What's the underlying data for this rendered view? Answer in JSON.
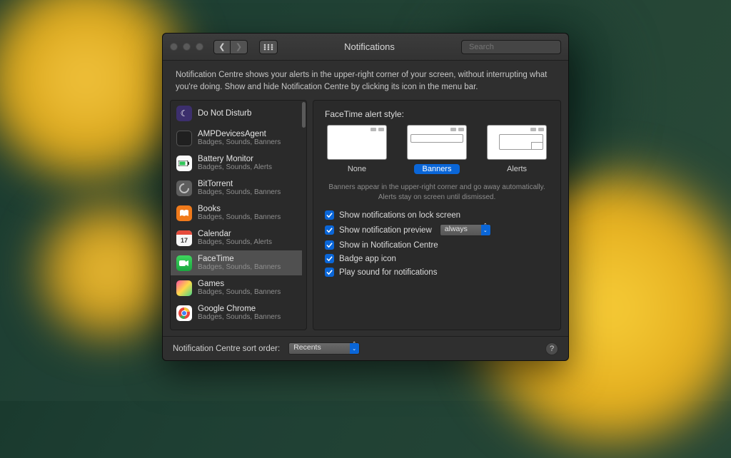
{
  "window": {
    "title": "Notifications",
    "search_placeholder": "Search"
  },
  "description": "Notification Centre shows your alerts in the upper-right corner of your screen, without interrupting what you're doing. Show and hide Notification Centre by clicking its icon in the menu bar.",
  "sidebar": {
    "items": [
      {
        "name": "Do Not Disturb",
        "sub": ""
      },
      {
        "name": "AMPDevicesAgent",
        "sub": "Badges, Sounds, Banners"
      },
      {
        "name": "Battery Monitor",
        "sub": "Badges, Sounds, Alerts"
      },
      {
        "name": "BitTorrent",
        "sub": "Badges, Sounds, Banners"
      },
      {
        "name": "Books",
        "sub": "Badges, Sounds, Banners"
      },
      {
        "name": "Calendar",
        "sub": "Badges, Sounds, Alerts"
      },
      {
        "name": "FaceTime",
        "sub": "Badges, Sounds, Banners"
      },
      {
        "name": "Games",
        "sub": "Badges, Sounds, Banners"
      },
      {
        "name": "Google Chrome",
        "sub": "Badges, Sounds, Banners"
      }
    ],
    "selected_index": 6
  },
  "detail": {
    "alert_style_title": "FaceTime alert style:",
    "styles": {
      "none": "None",
      "banners": "Banners",
      "alerts": "Alerts"
    },
    "selected_style": "banners",
    "hint": "Banners appear in the upper-right corner and go away automatically. Alerts stay on screen until dismissed.",
    "checks": {
      "lock_screen": "Show notifications on lock screen",
      "preview": "Show notification preview",
      "in_centre": "Show in Notification Centre",
      "badge": "Badge app icon",
      "sound": "Play sound for notifications"
    },
    "preview_mode": "always"
  },
  "footer": {
    "sort_label": "Notification Centre sort order:",
    "sort_value": "Recents"
  }
}
